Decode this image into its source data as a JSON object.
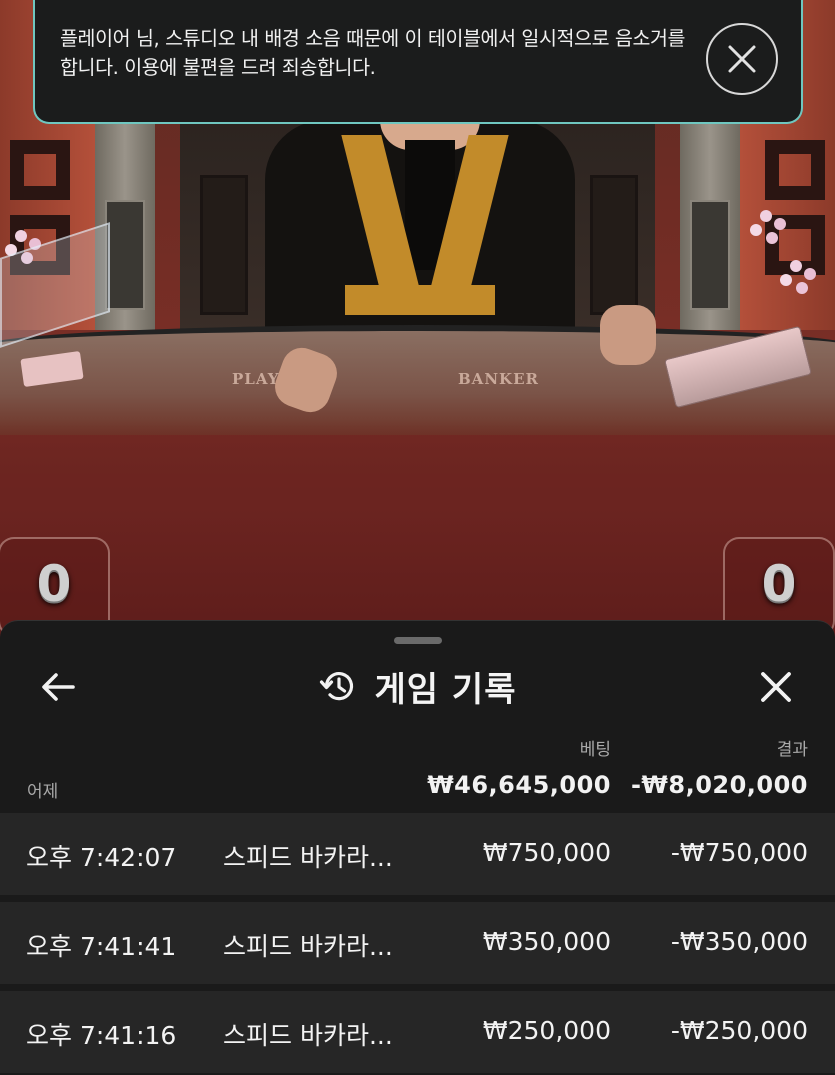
{
  "notice": {
    "message": "플레이어 님, 스튜디오 내 배경 소음 때문에 이 테이블에서 일시적으로 음소거를 합니다. 이용에 불편을 드려 죄송합니다.",
    "close_icon": "close-circle-icon"
  },
  "video": {
    "felt_player_label": "PLAYER",
    "felt_banker_label": "BANKER",
    "player_score": "0",
    "banker_score": "0"
  },
  "history": {
    "title": "게임 기록",
    "back_icon": "arrow-left-icon",
    "title_icon": "history-icon",
    "close_icon": "close-icon",
    "columns": {
      "bet": "베팅",
      "result": "결과"
    },
    "date_label": "어제",
    "total_bet": "₩46,645,000",
    "total_result": "-₩8,020,000",
    "rows": [
      {
        "time": "오후 7:42:07",
        "game": "스피드 바카라...",
        "bet": "₩750,000",
        "result": "-₩750,000"
      },
      {
        "time": "오후 7:41:41",
        "game": "스피드 바카라...",
        "bet": "₩350,000",
        "result": "-₩350,000"
      },
      {
        "time": "오후 7:41:16",
        "game": "스피드 바카라...",
        "bet": "₩250,000",
        "result": "-₩250,000"
      }
    ]
  },
  "colors": {
    "toast_border": "#6fc7c0",
    "sheet_bg": "#1a1a1a",
    "row_bg": "#262626"
  }
}
